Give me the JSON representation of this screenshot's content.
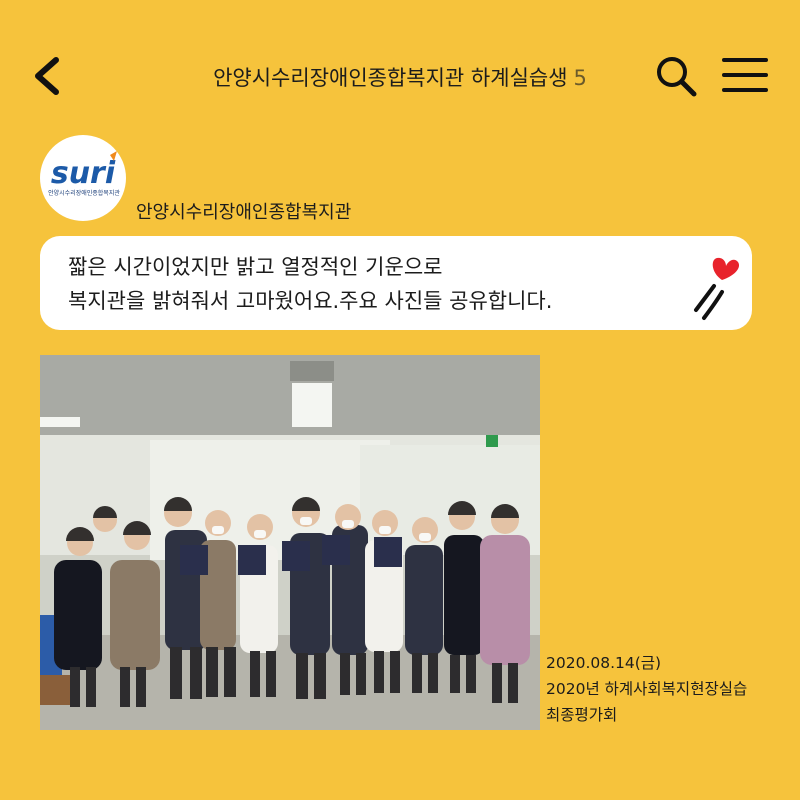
{
  "header": {
    "title": "안양시수리장애인종합복지관 하계실습생",
    "member_count": "5",
    "back_icon": "chevron-left-icon",
    "search_icon": "search-icon",
    "menu_icon": "hamburger-menu-icon"
  },
  "message": {
    "avatar_logo_text": "suri",
    "avatar_subtext": "안양시수리장애인종합복지관",
    "sender": "안양시수리장애인종합복지관",
    "lines": [
      "짧은 시간이었지만 밝고 열정적인 기운으로",
      "복지관을 밝혀줘서 고마웠어요.주요 사진들 공유합니다."
    ],
    "decoration_icon": "heart-icon",
    "photo_caption": [
      "2020.08.14(금)",
      "2020년 하계사회복지현장실습",
      "최종평가회"
    ]
  },
  "colors": {
    "background": "#f6c33c",
    "bubble": "#ffffff",
    "heart": "#e8232c",
    "logo_blue": "#1c5aa8"
  }
}
